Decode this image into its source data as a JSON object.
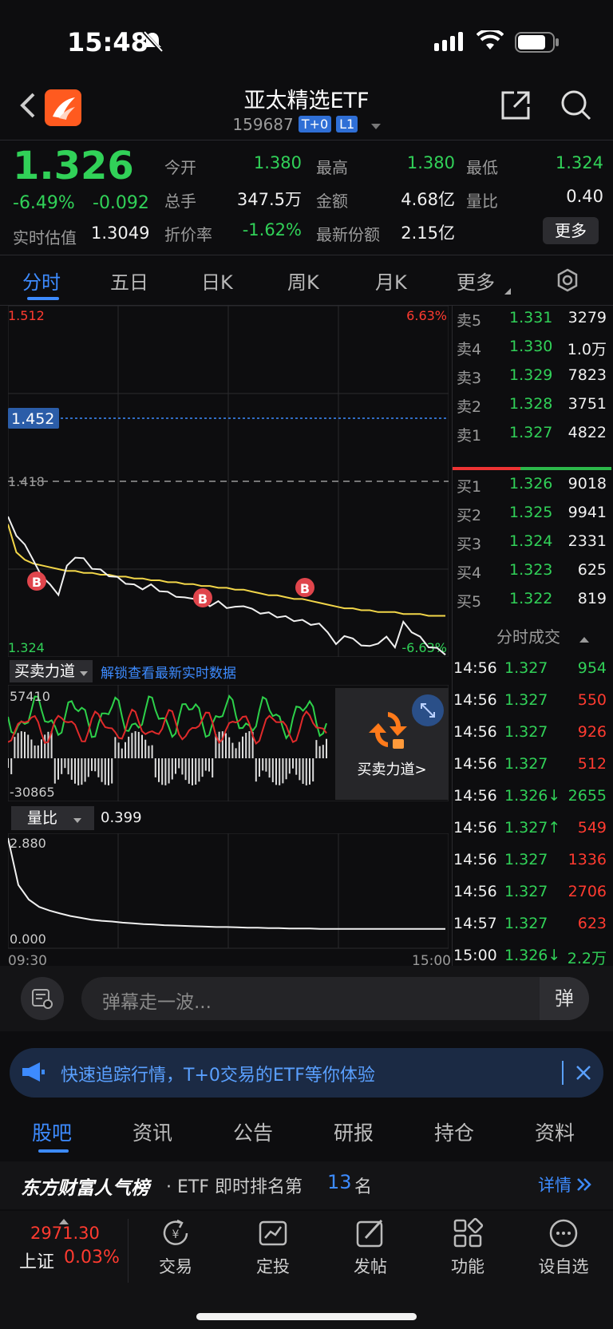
{
  "status": {
    "time": "15:48"
  },
  "header": {
    "title": "亚太精选ETF",
    "code": "159687",
    "tag1": "T+0",
    "tag2": "L1"
  },
  "quote": {
    "price": "1.326",
    "change_pct": "-6.49%",
    "change": "-0.092",
    "est_label": "实时估值",
    "est_value": "1.3049",
    "open_label": "今开",
    "open_value": "1.380",
    "high_label": "最高",
    "high_value": "1.380",
    "low_label": "最低",
    "low_value": "1.324",
    "vol_label": "总手",
    "vol_value": "347.5万",
    "amt_label": "金额",
    "amt_value": "4.68亿",
    "ratio_label": "量比",
    "ratio_value": "0.40",
    "disc_label": "折价率",
    "disc_value": "-1.62%",
    "share_label": "最新份额",
    "share_value": "2.15亿",
    "more_button": "更多"
  },
  "tabs": [
    "分时",
    "五日",
    "日K",
    "周K",
    "月K",
    "更多"
  ],
  "chart": {
    "top_price": "1.512",
    "top_pct": "6.63%",
    "ref_price": "1.452",
    "mid_price": "1.418",
    "low_price": "1.324",
    "low_pct": "-6.63%",
    "marker": "B",
    "lli_label": "买卖力道",
    "lli_link": "解锁查看最新实时数据",
    "lli_max": "57410",
    "lli_min": "-30865",
    "lli_promo": "买卖力道>",
    "vr_label": "量比",
    "vr_value": "0.399",
    "vr_max": "2.880",
    "vr_min": "0.000",
    "time_start": "09:30",
    "time_end": "15:00"
  },
  "chart_data": {
    "type": "line",
    "title": "",
    "xlabel": "",
    "ylabel": "",
    "x_range": [
      "09:30",
      "15:00"
    ],
    "ylim": [
      1.324,
      1.512
    ],
    "series": [],
    "price_line": [
      1.4,
      1.388,
      1.385,
      1.375,
      1.368,
      1.362,
      1.358,
      1.372,
      1.378,
      1.376,
      1.372,
      1.37,
      1.368,
      1.366,
      1.364,
      1.362,
      1.361,
      1.362,
      1.36,
      1.358,
      1.357,
      1.355,
      1.356,
      1.354,
      1.352,
      1.353,
      1.351,
      1.35,
      1.352,
      1.349,
      1.348,
      1.347,
      1.346,
      1.345,
      1.344,
      1.343,
      1.342,
      1.341,
      1.338,
      1.33,
      1.336,
      1.333,
      1.331,
      1.329,
      1.332,
      1.334,
      1.33,
      1.342,
      1.338,
      1.334,
      1.33,
      1.328,
      1.326
    ],
    "avg_line": [
      1.395,
      1.38,
      1.376,
      1.374,
      1.373,
      1.372,
      1.371,
      1.37,
      1.37,
      1.369,
      1.369,
      1.368,
      1.368,
      1.367,
      1.367,
      1.366,
      1.366,
      1.365,
      1.365,
      1.364,
      1.364,
      1.363,
      1.363,
      1.362,
      1.362,
      1.361,
      1.361,
      1.36,
      1.36,
      1.359,
      1.358,
      1.357,
      1.357,
      1.356,
      1.355,
      1.355,
      1.354,
      1.353,
      1.352,
      1.351,
      1.35,
      1.35,
      1.349,
      1.349,
      1.348,
      1.348,
      1.348,
      1.347,
      1.347,
      1.347,
      1.346,
      1.346,
      1.346
    ],
    "volume_ratio": [
      2.88,
      1.6,
      1.2,
      1.0,
      0.9,
      0.82,
      0.75,
      0.7,
      0.65,
      0.62,
      0.6,
      0.57,
      0.55,
      0.53,
      0.52,
      0.5,
      0.49,
      0.48,
      0.47,
      0.46,
      0.45,
      0.45,
      0.44,
      0.43,
      0.43,
      0.42,
      0.42,
      0.41,
      0.41,
      0.41,
      0.4,
      0.4,
      0.4,
      0.4,
      0.4,
      0.399,
      0.399,
      0.399,
      0.399,
      0.399,
      0.399,
      0.399,
      0.399
    ]
  },
  "orderbook": {
    "asks": [
      {
        "label": "卖5",
        "price": "1.331",
        "vol": "3279"
      },
      {
        "label": "卖4",
        "price": "1.330",
        "vol": "1.0万"
      },
      {
        "label": "卖3",
        "price": "1.329",
        "vol": "7823"
      },
      {
        "label": "卖2",
        "price": "1.328",
        "vol": "3751"
      },
      {
        "label": "卖1",
        "price": "1.327",
        "vol": "4822"
      }
    ],
    "bids": [
      {
        "label": "买1",
        "price": "1.326",
        "vol": "9018"
      },
      {
        "label": "买2",
        "price": "1.325",
        "vol": "9941"
      },
      {
        "label": "买3",
        "price": "1.324",
        "vol": "2331"
      },
      {
        "label": "买4",
        "price": "1.323",
        "vol": "625"
      },
      {
        "label": "买5",
        "price": "1.322",
        "vol": "819"
      }
    ]
  },
  "trades": {
    "title": "分时成交",
    "rows": [
      {
        "time": "14:56",
        "price": "1.327",
        "vol": "954"
      },
      {
        "time": "14:56",
        "price": "1.327",
        "vol": "550"
      },
      {
        "time": "14:56",
        "price": "1.327",
        "vol": "926"
      },
      {
        "time": "14:56",
        "price": "1.327",
        "vol": "512"
      },
      {
        "time": "14:56",
        "price": "1.326↓",
        "vol": "2655"
      },
      {
        "time": "14:56",
        "price": "1.327↑",
        "vol": "549"
      },
      {
        "time": "14:56",
        "price": "1.327",
        "vol": "1336"
      },
      {
        "time": "14:56",
        "price": "1.327",
        "vol": "2706"
      },
      {
        "time": "14:57",
        "price": "1.327",
        "vol": "623"
      },
      {
        "time": "15:00",
        "price": "1.326↓",
        "vol": "2.2万"
      }
    ]
  },
  "danmu": {
    "placeholder": "弹幕走一波...",
    "button": "弹"
  },
  "banner": {
    "text": "快速追踪行情，T+0交易的ETF等你体验"
  },
  "subtabs": [
    "股吧",
    "资讯",
    "公告",
    "研报",
    "持仓",
    "资料"
  ],
  "rank": {
    "brand": "东方财富人气榜",
    "pre": "· ETF 即时排名第",
    "num": "13",
    "post": "名",
    "detail": "详情"
  },
  "bottomnav": {
    "index_value": "2971.30",
    "index_name": "上证",
    "index_pct": "0.03%",
    "items": [
      "交易",
      "定投",
      "发帖",
      "功能",
      "设自选"
    ]
  }
}
